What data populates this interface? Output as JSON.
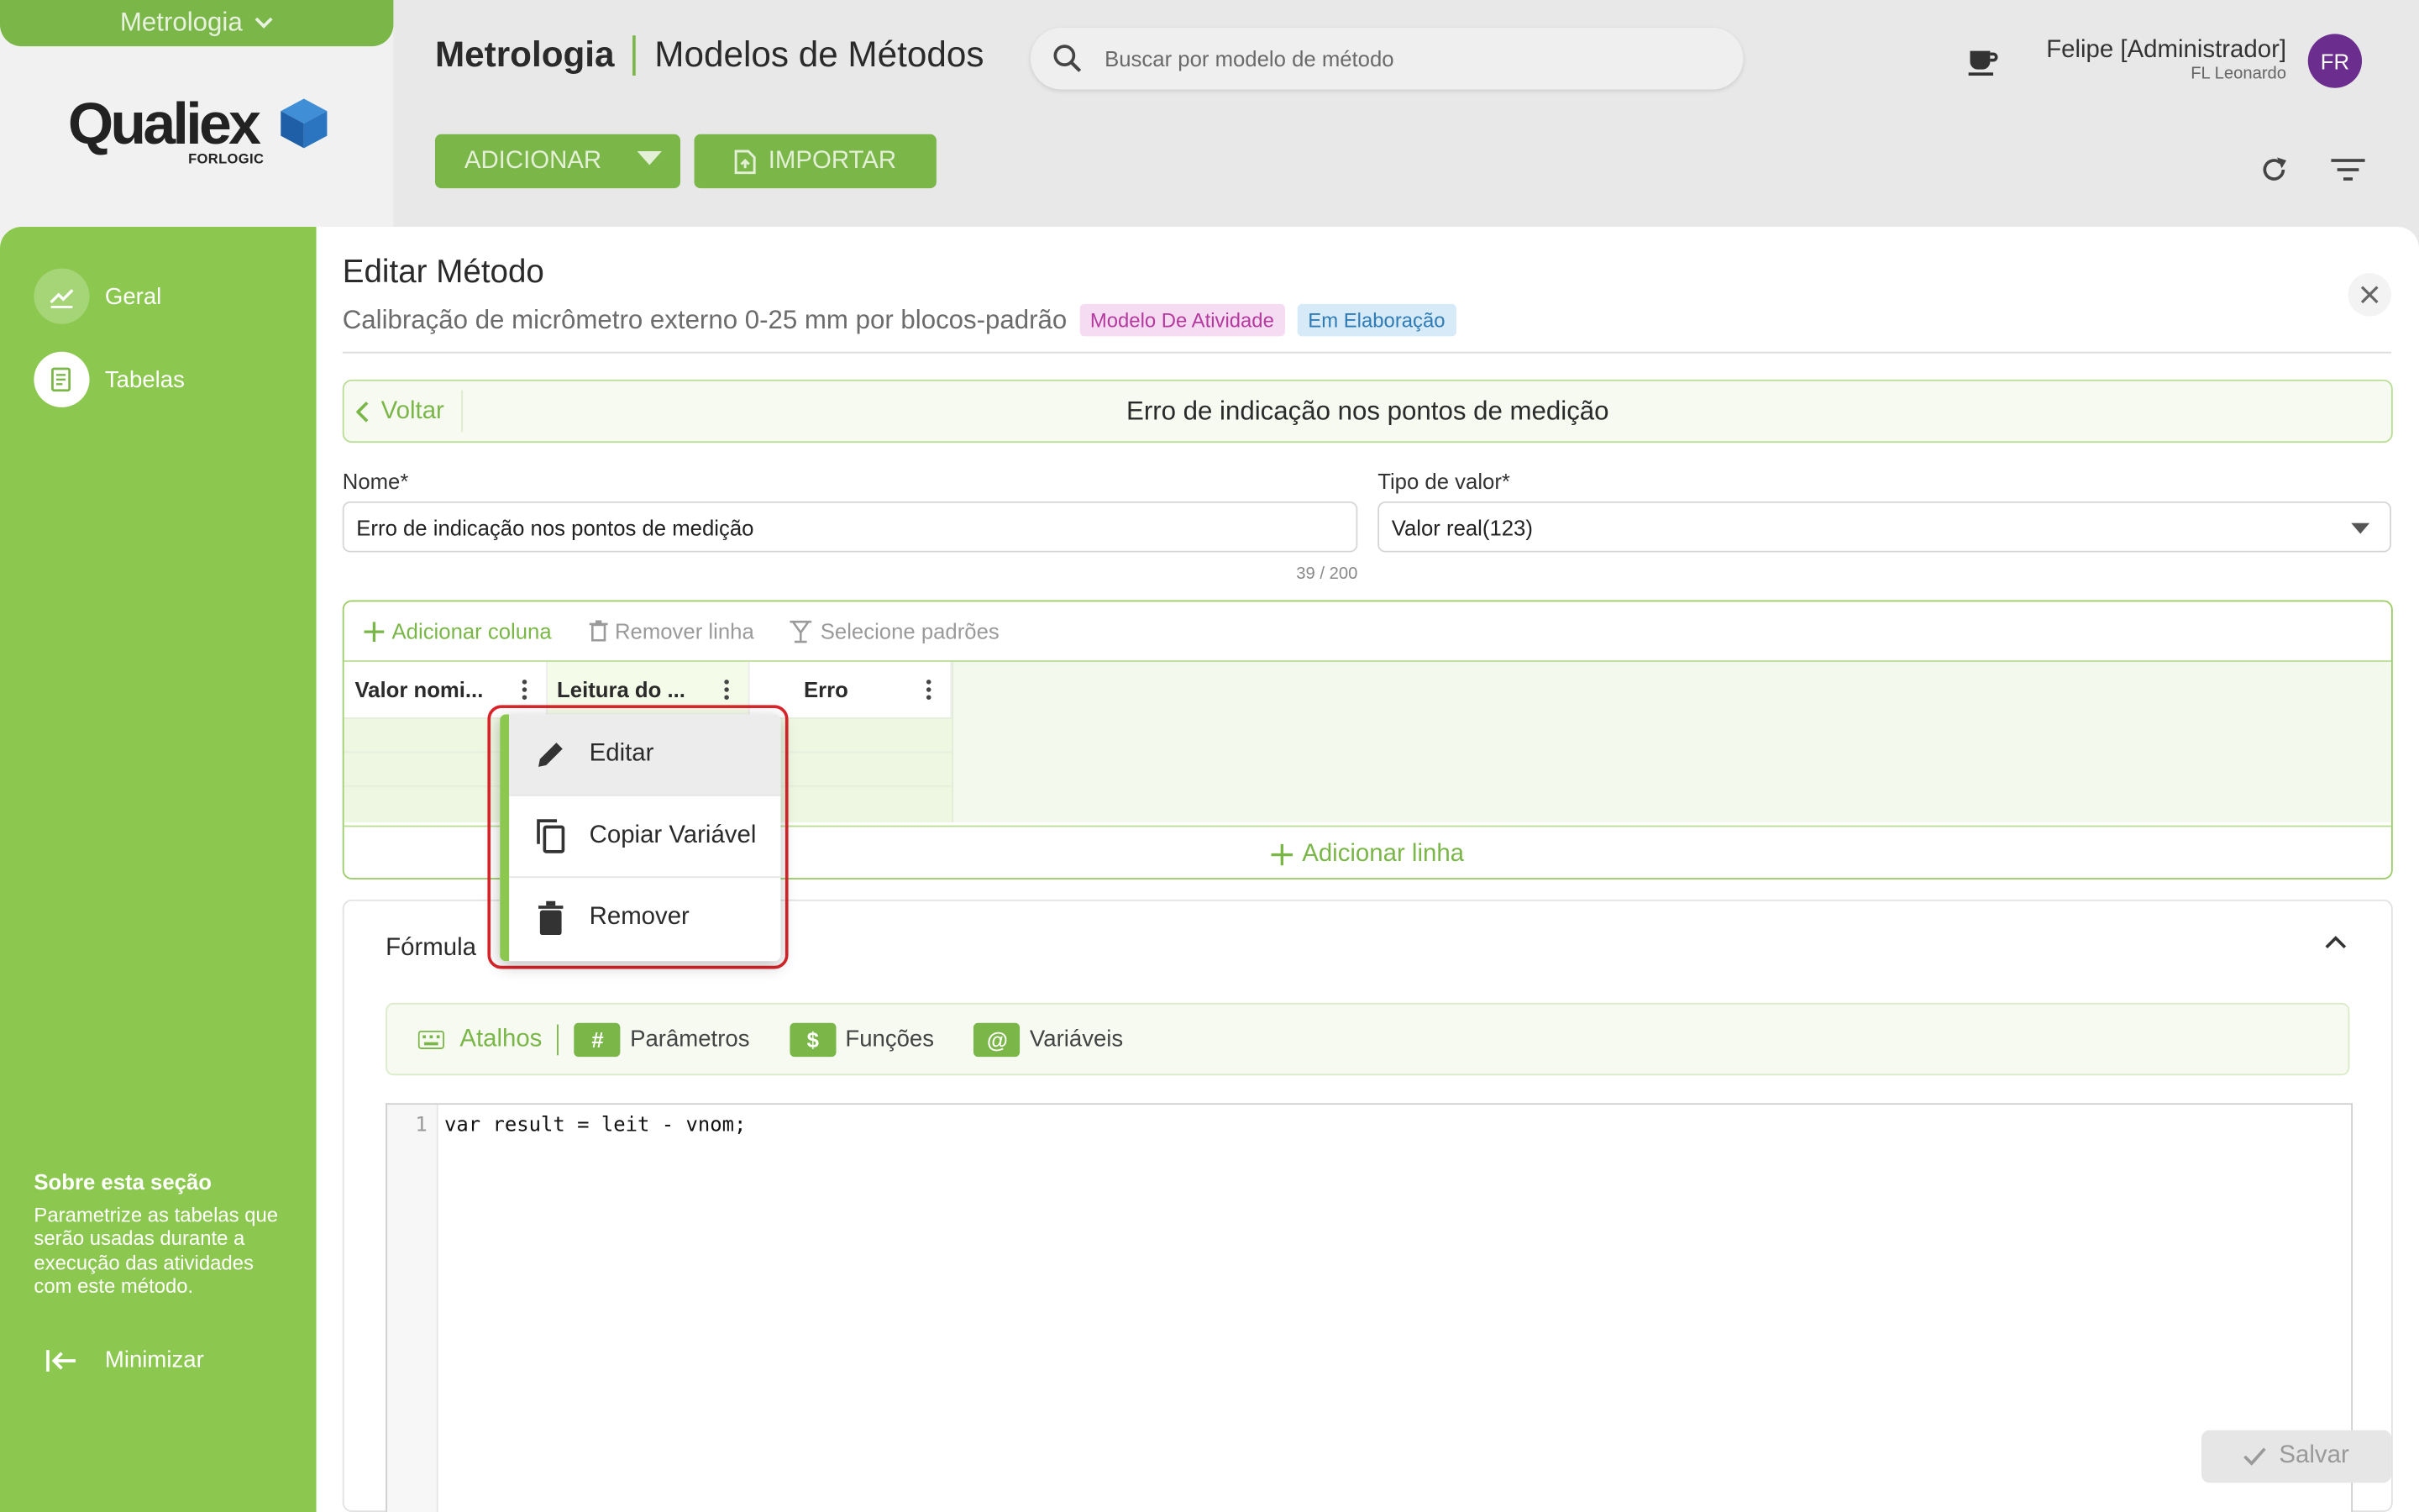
{
  "app": {
    "module_name": "Metrologia",
    "logo_text": "Qualiex",
    "logo_sub": "FORLOGIC",
    "header_module": "Metrologia",
    "header_page": "Modelos de Métodos",
    "search_placeholder": "Buscar por modelo de método",
    "add_label": "ADICIONAR",
    "import_label": "IMPORTAR",
    "user_name": "Felipe [Administrador]",
    "user_company": "FL Leonardo",
    "avatar_initials": "FR"
  },
  "nav": {
    "items": [
      {
        "label": "Geral",
        "icon": "geral-icon"
      },
      {
        "label": "Tabelas",
        "icon": "tabelas-icon"
      }
    ],
    "about_title": "Sobre esta seção",
    "about_text": "Parametrize as tabelas que serão usadas durante a execução das atividades com este método.",
    "minimize_label": "Minimizar"
  },
  "editor": {
    "title": "Editar Método",
    "subtitle": "Calibração de micrômetro externo 0-25 mm por blocos-padrão",
    "tag_model": "Modelo De Atividade",
    "tag_status": "Em Elaboração",
    "back_label": "Voltar",
    "section_title": "Erro de indicação nos pontos de medição"
  },
  "form": {
    "name_label": "Nome*",
    "name_value": "Erro de indicação nos pontos de medição",
    "name_counter": "39 / 200",
    "type_label": "Tipo de valor*",
    "type_value": "Valor real(123)"
  },
  "table": {
    "toolbar": {
      "add_column": "Adicionar coluna",
      "remove_row": "Remover linha",
      "select_standards": "Selecione padrões"
    },
    "columns": [
      "Valor nomi...",
      "Leitura do ...",
      "Erro"
    ],
    "add_row": "Adicionar linha"
  },
  "context_menu": {
    "items": [
      {
        "label": "Editar",
        "icon": "pencil-icon"
      },
      {
        "label": "Copiar Variável",
        "icon": "copy-icon"
      },
      {
        "label": "Remover",
        "icon": "trash-icon"
      }
    ]
  },
  "formula": {
    "title": "Fórmula",
    "shortcuts_label": "Atalhos",
    "params_badge": "#",
    "params_label": "Parâmetros",
    "functions_badge": "$",
    "functions_label": "Funções",
    "variables_badge": "@",
    "variables_label": "Variáveis",
    "line_number": "1",
    "code": "var result = leit - vnom;"
  },
  "save_label": "Salvar",
  "colors": {
    "brand_green": "#8cc850",
    "accent_green": "#7ab648",
    "highlight_red": "#d9252a",
    "avatar_purple": "#6b2e8e"
  }
}
